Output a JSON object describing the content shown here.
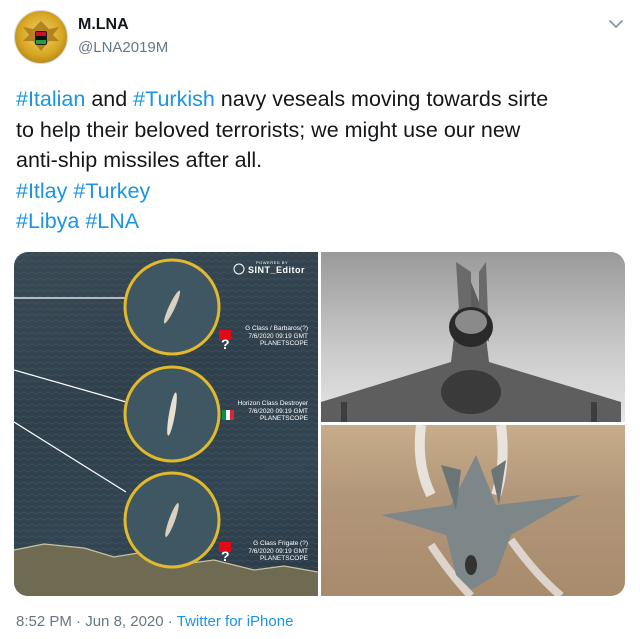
{
  "account": {
    "display_name": "M.LNA",
    "handle": "@LNA2019M"
  },
  "tweet": {
    "lines": [
      [
        {
          "text": "#Italian",
          "type": "hashtag"
        },
        {
          "text": " and ",
          "type": "plain"
        },
        {
          "text": "#Turkish",
          "type": "hashtag"
        },
        {
          "text": " navy veseals moving towards sirte",
          "type": "plain"
        }
      ],
      [
        {
          "text": "to help their beloved terrorists; we might use our new",
          "type": "plain"
        }
      ],
      [
        {
          "text": "anti-ship missiles after all.",
          "type": "plain"
        }
      ],
      [
        {
          "text": "#Itlay",
          "type": "hashtag"
        },
        {
          "text": " ",
          "type": "plain"
        },
        {
          "text": "#Turkey",
          "type": "hashtag"
        }
      ],
      [
        {
          "text": "#Libya",
          "type": "hashtag"
        },
        {
          "text": " ",
          "type": "plain"
        },
        {
          "text": "#LNA",
          "type": "hashtag"
        }
      ]
    ]
  },
  "media": {
    "watermark": "SINT_Editor",
    "watermark_small": "POWERED BY",
    "ships": [
      {
        "class": "G Class / Barbaros(?)",
        "datetime": "7/6/2020 09:19 GMT",
        "source": "PLANETSCOPE",
        "flag": "turkey"
      },
      {
        "class": "Horizon Class Destroyer",
        "datetime": "7/6/2020 09:19 GMT",
        "source": "PLANETSCOPE",
        "flag": "italy"
      },
      {
        "class": "G Class Frigate (?)",
        "datetime": "7/6/2020 09:19 GMT",
        "source": "PLANETSCOPE",
        "flag": "turkey"
      }
    ]
  },
  "footer": {
    "time": "8:52 PM",
    "separator1": " · ",
    "date": "Jun 8, 2020",
    "separator2": " · ",
    "source": "Twitter for iPhone"
  },
  "colors": {
    "hashtag": "#1b95e0",
    "secondary_text": "#657786",
    "primary_text": "#14171a"
  }
}
